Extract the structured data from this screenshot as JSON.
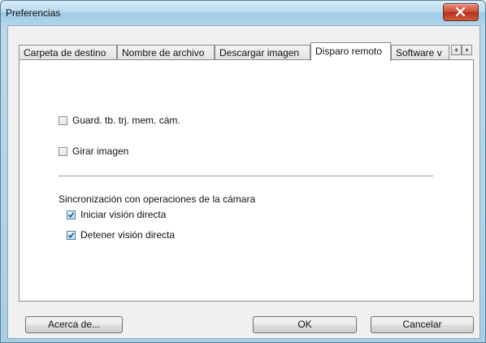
{
  "window": {
    "title": "Preferencias"
  },
  "tabs": [
    {
      "label": "Carpeta de destino"
    },
    {
      "label": "Nombre de archivo"
    },
    {
      "label": "Descargar imagen"
    },
    {
      "label": "Disparo remoto"
    },
    {
      "label": "Software v"
    }
  ],
  "active_tab": "Disparo remoto",
  "options": {
    "save_card": {
      "label": "Guard. tb. trj. mem. cám.",
      "checked": false
    },
    "rotate": {
      "label": "Girar imagen",
      "checked": false
    }
  },
  "sync": {
    "heading": "Sincronización con operaciones de la cámara",
    "start_live": {
      "label": "Iniciar visión directa",
      "checked": true
    },
    "stop_live": {
      "label": "Detener visión directa",
      "checked": true
    }
  },
  "buttons": {
    "about": "Acerca de...",
    "ok": "OK",
    "cancel": "Cancelar"
  },
  "colors": {
    "close_button": "#c84a32",
    "titlebar": "#b9dbee",
    "check_blue": "#3c7fb1"
  }
}
